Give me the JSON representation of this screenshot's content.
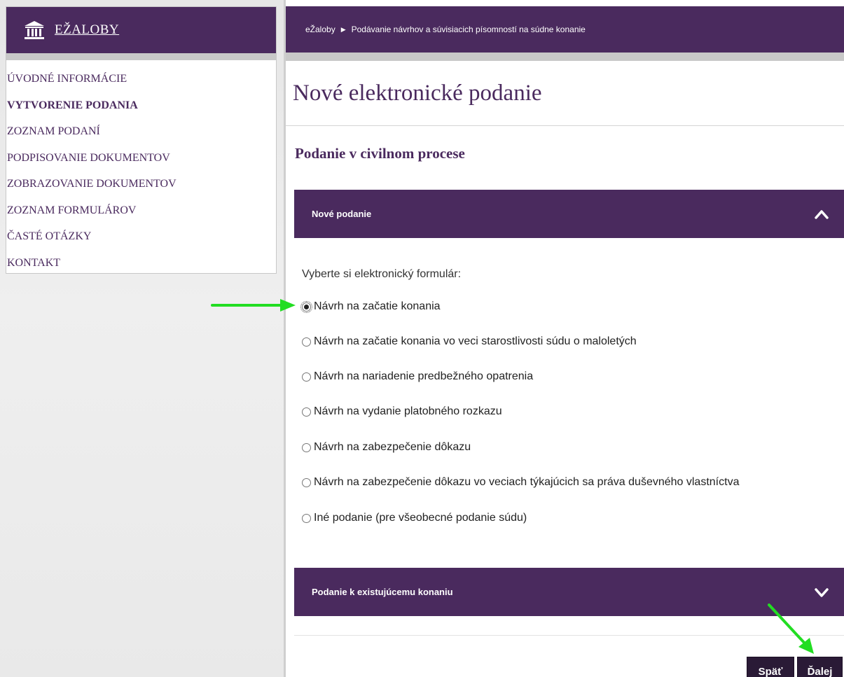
{
  "sidebar": {
    "brand": "EŽALOBY",
    "items": [
      {
        "label": "ÚVODNÉ INFORMÁCIE"
      },
      {
        "label": "VYTVORENIE PODANIA"
      },
      {
        "label": "ZOZNAM PODANÍ"
      },
      {
        "label": "PODPISOVANIE DOKUMENTOV"
      },
      {
        "label": "ZOBRAZOVANIE DOKUMENTOV"
      },
      {
        "label": "ZOZNAM FORMULÁROV"
      },
      {
        "label": "ČASTÉ OTÁZKY"
      },
      {
        "label": "KONTAKT"
      }
    ]
  },
  "breadcrumb": {
    "home": "eŽaloby",
    "current": "Podávanie návrhov a súvisiacich písomností na súdne konanie"
  },
  "page": {
    "title": "Nové elektronické podanie",
    "subtitle": "Podanie v civilnom procese"
  },
  "panels": {
    "new": "Nové podanie",
    "existing": "Podanie k existujúcemu konaniu"
  },
  "form": {
    "label": "Vyberte si elektronický formulár:",
    "options": [
      "Návrh na začatie konania",
      "Návrh na začatie konania vo veci starostlivosti súdu o maloletých",
      "Návrh na nariadenie predbežného opatrenia",
      "Návrh na vydanie platobného rozkazu",
      "Návrh na zabezpečenie dôkazu",
      "Návrh na zabezpečenie dôkazu vo veciach týkajúcich sa práva duševného vlastníctva",
      "Iné podanie (pre všeobecné podanie súdu)"
    ],
    "selected_index": 0
  },
  "buttons": {
    "back": "Späť",
    "next": "Ďalej"
  },
  "colors": {
    "brand": "#4a2a5e",
    "button": "#2a1a36",
    "annotation": "#22dd22"
  }
}
